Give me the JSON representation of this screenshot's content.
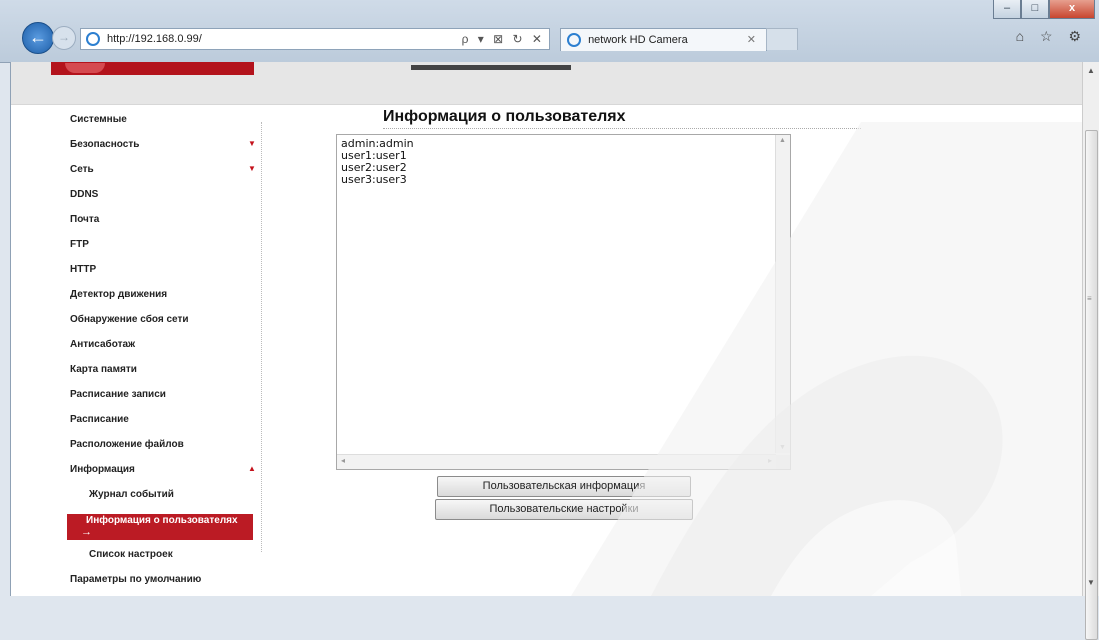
{
  "browser": {
    "url": "http://192.168.0.99/",
    "tab_title": "network HD Camera",
    "search_controls": "ρ ▾ ⊠ ↻ ✕",
    "tab_close": "✕",
    "back_glyph": "←",
    "forward_glyph": "→",
    "right_tools": "⌂ ☆ ⚙",
    "window_buttons": {
      "minimize": "–",
      "maximize": "□",
      "close": "x"
    }
  },
  "sidebar": {
    "items": [
      {
        "label": "Системные"
      },
      {
        "label": "Безопасность",
        "arrow": "▼"
      },
      {
        "label": "Сеть",
        "arrow": "▼"
      },
      {
        "label": "DDNS"
      },
      {
        "label": "Почта"
      },
      {
        "label": "FTP"
      },
      {
        "label": "HTTP"
      },
      {
        "label": "Детектор движения"
      },
      {
        "label": "Обнаружение сбоя сети"
      },
      {
        "label": "Антисаботаж"
      },
      {
        "label": "Карта памяти"
      },
      {
        "label": "Расписание записи"
      },
      {
        "label": "Расписание"
      },
      {
        "label": "Расположение файлов"
      },
      {
        "label": "Информация",
        "arrow": "▲"
      }
    ],
    "subitems": [
      {
        "label": "Журнал событий"
      },
      {
        "label": "Информация о пользователях",
        "active": true,
        "arrow": "→"
      },
      {
        "label": "Список настроек"
      }
    ],
    "bottom_item": "Параметры по умолчанию",
    "active_color": "#bb1b24"
  },
  "main": {
    "title": "Информация о пользователях",
    "users": [
      "admin:admin",
      "user1:user1",
      "user2:user2",
      "user3:user3"
    ],
    "buttons": {
      "user_info": "Пользовательская информация",
      "user_settings": "Пользовательские настройки"
    }
  },
  "colors": {
    "brand_red": "#b3131c",
    "watermark": "#eeeeee"
  }
}
